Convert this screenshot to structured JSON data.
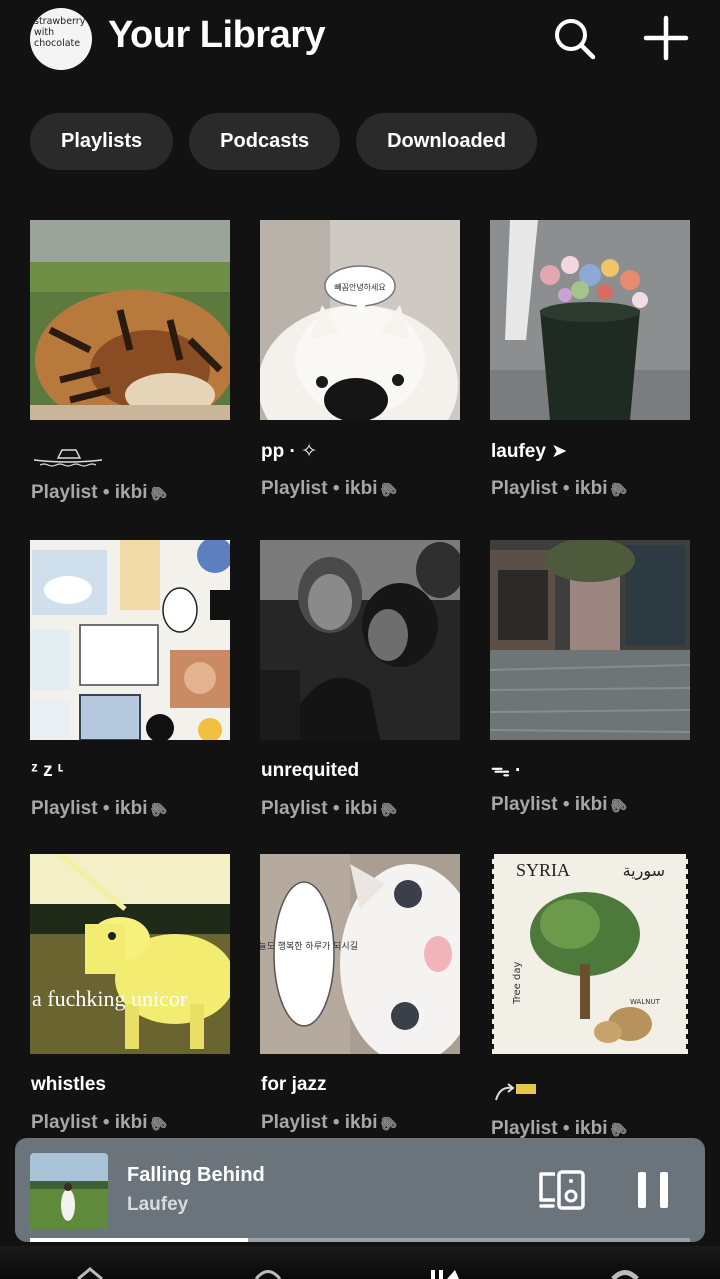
{
  "header": {
    "avatar_text": "strawberry with chocolate",
    "title": "Your Library",
    "search_icon": "search-icon",
    "add_icon": "plus-icon"
  },
  "filters": [
    {
      "label": "Playlists"
    },
    {
      "label": "Podcasts"
    },
    {
      "label": "Downloaded"
    }
  ],
  "playlists": [
    {
      "title": "",
      "subtitle": "Playlist • ikbi",
      "art": "sleeping tiger"
    },
    {
      "title": "pp · ✧",
      "subtitle": "Playlist • ikbi",
      "art": "white dog with speech bubble"
    },
    {
      "title": "laufey ➤",
      "subtitle": "Playlist • ikbi",
      "art": "flower bucket on street"
    },
    {
      "title": "ᶻ z ᶫ",
      "subtitle": "Playlist • ikbi",
      "art": "sticker collage"
    },
    {
      "title": "unrequited",
      "subtitle": "Playlist • ikbi",
      "art": "people on a bus"
    },
    {
      "title": "ᯓ ·",
      "subtitle": "Playlist • ikbi",
      "art": "rainy street"
    },
    {
      "title": "whistles",
      "subtitle": "Playlist • ikbi",
      "art": "yellow unicorn"
    },
    {
      "title": "for jazz",
      "subtitle": "Playlist • ikbi",
      "art": "white cat with speech bubble"
    },
    {
      "title": "",
      "subtitle": "Playlist • ikbi",
      "art": "Syria walnut stamp"
    }
  ],
  "art_text": {
    "dog_bubble": "빼꼼안녕하세요",
    "unicorn_caption": "a fuchking unicor",
    "cat_bubble": "오늘도 행복한 하루가 되시길",
    "stamp_title": "SYRIA",
    "stamp_arabic": "سورية",
    "stamp_side": "Tree day",
    "stamp_walnut": "WALNUT"
  },
  "now_playing": {
    "track": "Falling Behind",
    "artist": "Laufey",
    "progress": 0.33,
    "device_icon": "connect-device-icon",
    "pause_icon": "pause-icon"
  },
  "colors": {
    "background": "#121212",
    "chip": "#2a2a2a",
    "player": "#6c747b",
    "subtitle": "#a7a7a7"
  }
}
